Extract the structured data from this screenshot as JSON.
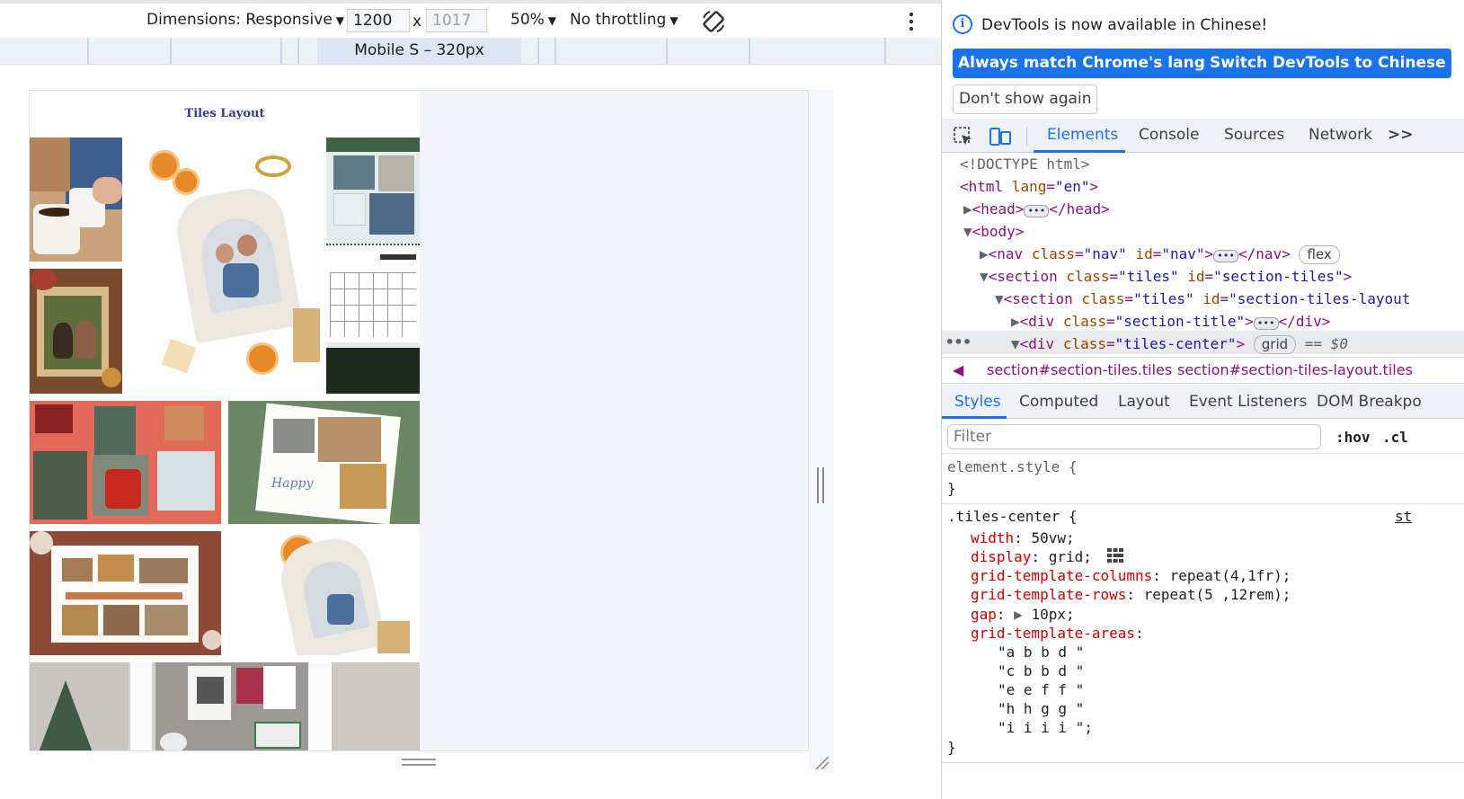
{
  "device_toolbar": {
    "dimensions_label": "Dimensions: Responsive",
    "width_value": "1200",
    "times": "x",
    "height_placeholder": "1017",
    "zoom": "50%",
    "throttling": "No throttling",
    "preset_label": "Mobile S – 320px"
  },
  "page": {
    "title": "Tiles Layout"
  },
  "devtools": {
    "info_message": "DevTools is now available in Chinese!",
    "btn_match_language": "Always match Chrome's language",
    "btn_switch_chinese": "Switch DevTools to Chinese",
    "btn_dont_show": "Don't show again",
    "tabs": [
      "Elements",
      "Console",
      "Sources",
      "Network"
    ],
    "more_tabs": ">>",
    "dom": {
      "doctype": "<!DOCTYPE html>",
      "html_open": "<html",
      "html_attr": "lang",
      "html_val": "\"en\"",
      "head_open": "<head>",
      "head_close": "</head>",
      "body_open": "<body>",
      "nav_open": "<nav",
      "nav_class_attr": "class",
      "nav_class_val": "\"nav\"",
      "nav_id_attr": "id",
      "nav_id_val": "\"nav\"",
      "nav_close": "</nav>",
      "nav_badge": "flex",
      "section1_open": "<section",
      "section1_class_val": "\"tiles\"",
      "section1_id_val": "\"section-tiles\"",
      "section2_class_val": "\"tiles\"",
      "section2_id_val": "\"section-tiles-layout",
      "div1_open": "<div",
      "div1_class_val": "\"section-title\"",
      "div1_close": "</div>",
      "div2_class_val": "\"tiles-center\"",
      "div2_badge": "grid",
      "div2_eq": "== $0"
    },
    "breadcrumbs": [
      "section#section-tiles.tiles",
      "section#section-tiles-layout.tiles"
    ],
    "sub_tabs": [
      "Styles",
      "Computed",
      "Layout",
      "Event Listeners",
      "DOM Breakpo"
    ],
    "filter_placeholder": "Filter",
    "hov": ":hov",
    "cls": ".cl",
    "styles": {
      "element_style": "element.style {",
      "close_brace": "}",
      "selector": ".tiles-center {",
      "source": "st",
      "props": [
        {
          "name": "width",
          "value": "50vw;"
        },
        {
          "name": "display",
          "value": "grid;"
        },
        {
          "name": "grid-template-columns",
          "value": "repeat(4,1fr);"
        },
        {
          "name": "grid-template-rows",
          "value": "repeat(5 ,12rem);"
        },
        {
          "name": "gap",
          "value": "10px;"
        },
        {
          "name": "grid-template-areas",
          "value": ""
        }
      ],
      "areas": [
        "\"a b b d \"",
        "\"c b b d \"",
        "\"e e f f \"",
        "\"h h g g \"",
        "\"i i i i \";"
      ]
    }
  },
  "colors": {
    "accent": "#1a73e8",
    "tag": "#881280",
    "attr": "#994500",
    "value": "#1a1aa6",
    "prop": "#c80000"
  },
  "icons": [
    "more-vert-icon",
    "rotate-icon",
    "info-icon",
    "inspect-icon",
    "device-toggle-icon",
    "chevron-left-icon",
    "triangle-right-icon",
    "triangle-down-icon",
    "grid-editor-icon",
    "resize-handle-icon"
  ]
}
